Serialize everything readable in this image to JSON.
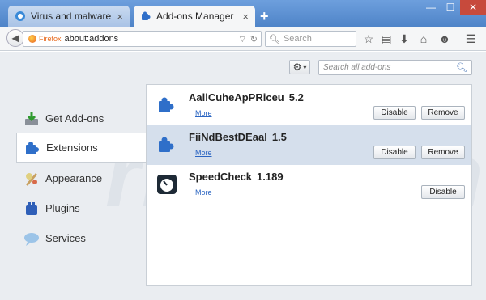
{
  "tabs": [
    {
      "label": "Virus and malware removal...",
      "close": "×"
    },
    {
      "label": "Add-ons Manager",
      "close": "×"
    }
  ],
  "new_tab": "+",
  "window_controls": {
    "minimize": "—",
    "maximize": "☐",
    "close": "✕"
  },
  "navbar": {
    "identity_label": "Firefox",
    "url": "about:addons",
    "search_placeholder": "Search"
  },
  "addons_toolbar": {
    "search_placeholder": "Search all add-ons"
  },
  "categories": [
    {
      "label": "Get Add-ons",
      "icon": "get-addons-icon"
    },
    {
      "label": "Extensions",
      "icon": "extensions-icon",
      "selected": true
    },
    {
      "label": "Appearance",
      "icon": "appearance-icon"
    },
    {
      "label": "Plugins",
      "icon": "plugins-icon"
    },
    {
      "label": "Services",
      "icon": "services-icon"
    }
  ],
  "addons": [
    {
      "name": "AallCuheApPRiceu",
      "version": "5.2",
      "more": "More",
      "disable": "Disable",
      "remove": "Remove"
    },
    {
      "name": "FiiNdBestDEaal",
      "version": "1.5",
      "more": "More",
      "disable": "Disable",
      "remove": "Remove",
      "selected": true
    },
    {
      "name": "SpeedCheck",
      "version": "1.189",
      "more": "More",
      "disable": "Disable"
    }
  ],
  "watermark": "risk.com",
  "colors": {
    "accent": "#2b65c2",
    "titlebar": "#5a8fd0",
    "selected_row": "#d5dfec"
  }
}
